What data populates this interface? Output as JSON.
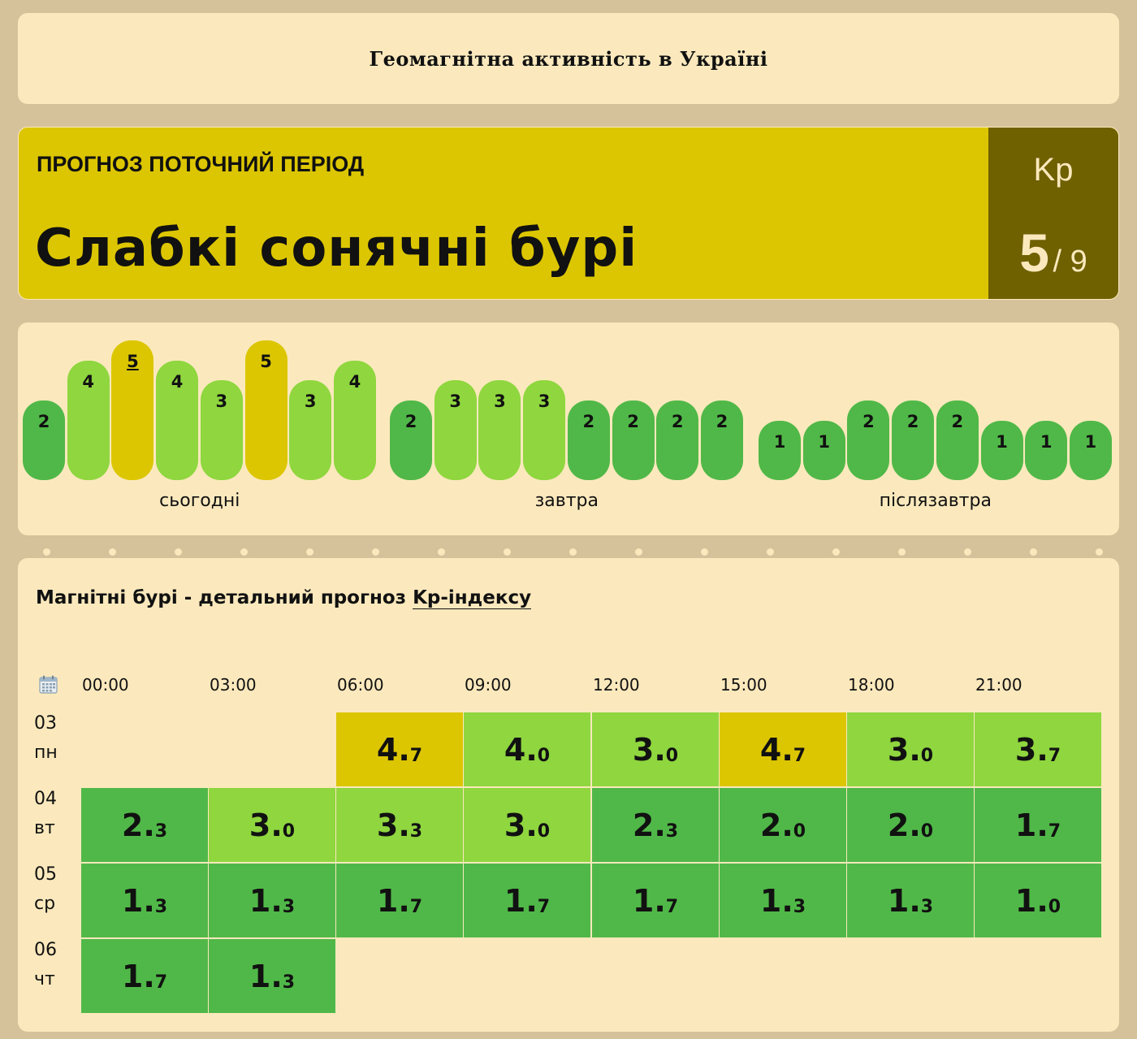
{
  "header": {
    "title": "Геомагнітна активність в Україні"
  },
  "forecast": {
    "period_label": "ПРОГНОЗ ПОТОЧНИЙ ПЕРІОД",
    "title": "Слабкі сонячні бурі",
    "kp_label": "Kp",
    "kp_value": "5",
    "kp_max": "/ 9"
  },
  "colors": {
    "dark_green": "#50b848",
    "light_green": "#8fd63f",
    "yellow": "#dcc601",
    "kp_box": "#6f6000",
    "card": "#fbe9bd",
    "page": "#d6c29a"
  },
  "bar_chart": {
    "days": [
      {
        "label": "сьогодні",
        "values": [
          2,
          4,
          5,
          4,
          3,
          5,
          3,
          4
        ],
        "current_index": 2
      },
      {
        "label": "завтра",
        "values": [
          2,
          3,
          3,
          3,
          2,
          2,
          2,
          2
        ],
        "current_index": -1
      },
      {
        "label": "післязавтра",
        "values": [
          1,
          1,
          2,
          2,
          2,
          1,
          1,
          1
        ],
        "current_index": -1
      }
    ]
  },
  "detail": {
    "title_prefix": "Магнітні бурі - детальний прогноз ",
    "title_link": "Kp-індексу",
    "calendar_icon": "calendar-icon",
    "times": [
      "00:00",
      "03:00",
      "06:00",
      "09:00",
      "12:00",
      "15:00",
      "18:00",
      "21:00"
    ],
    "rows": [
      {
        "date": "03",
        "weekday": "пн",
        "values": [
          null,
          null,
          "4.7",
          "4.0",
          "3.0",
          "4.7",
          "3.0",
          "3.7"
        ]
      },
      {
        "date": "04",
        "weekday": "вт",
        "values": [
          "2.3",
          "3.0",
          "3.3",
          "3.0",
          "2.3",
          "2.0",
          "2.0",
          "1.7"
        ]
      },
      {
        "date": "05",
        "weekday": "ср",
        "values": [
          "1.3",
          "1.3",
          "1.7",
          "1.7",
          "1.7",
          "1.3",
          "1.3",
          "1.0"
        ]
      },
      {
        "date": "06",
        "weekday": "чт",
        "values": [
          "1.7",
          "1.3",
          null,
          null,
          null,
          null,
          null,
          null
        ]
      }
    ]
  }
}
